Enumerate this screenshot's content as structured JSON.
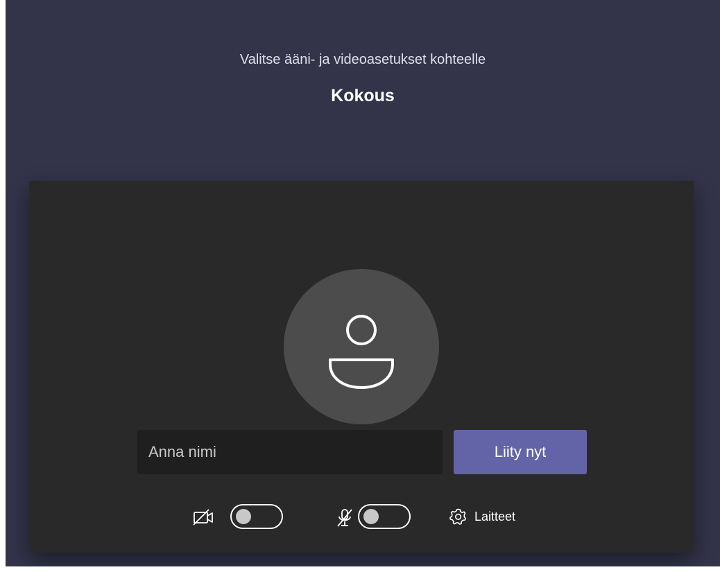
{
  "header": {
    "subtitle": "Valitse ääni- ja videoasetukset kohteelle",
    "meeting_title": "Kokous"
  },
  "prejoin": {
    "avatar_icon": "person-icon",
    "name_input": {
      "placeholder": "Anna nimi",
      "value": ""
    },
    "join_button_label": "Liity nyt",
    "controls": {
      "camera": {
        "icon": "camera-off-icon",
        "on": false
      },
      "microphone": {
        "icon": "mic-off-icon",
        "on": false
      },
      "devices": {
        "icon": "gear-icon",
        "label": "Laitteet"
      }
    }
  },
  "colors": {
    "background": "#33344a",
    "panel": "#292929",
    "avatar": "#4c4c4c",
    "input": "#1f1f1f",
    "accent": "#6264a7",
    "text": "#ffffff"
  }
}
